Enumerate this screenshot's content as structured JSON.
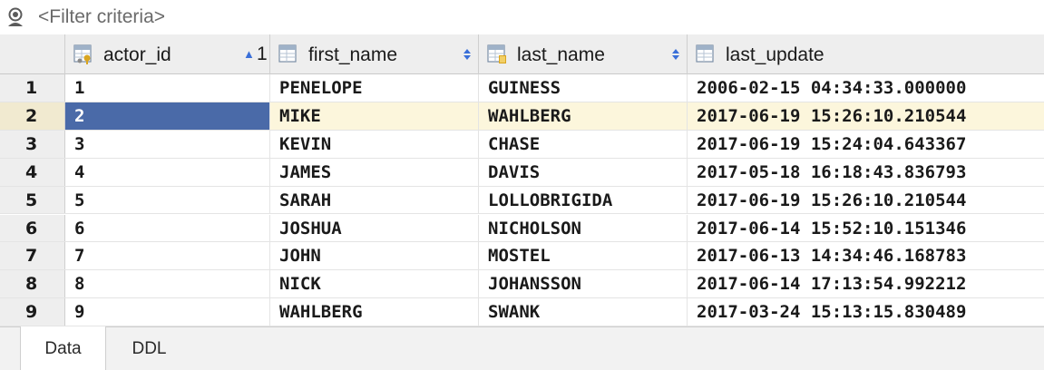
{
  "filter": {
    "placeholder": "<Filter criteria>"
  },
  "columns": [
    {
      "label": "actor_id",
      "icon": "primary-key-column-icon",
      "sort": "ascending",
      "sort_order": "1"
    },
    {
      "label": "first_name",
      "icon": "column-icon",
      "sort": "none"
    },
    {
      "label": "last_name",
      "icon": "indexed-column-icon",
      "sort": "none"
    },
    {
      "label": "last_update",
      "icon": "column-icon"
    }
  ],
  "rows": [
    {
      "num": "1",
      "cells": [
        "1",
        "PENELOPE",
        "GUINESS",
        "2006-02-15 04:34:33.000000"
      ]
    },
    {
      "num": "2",
      "cells": [
        "2",
        "MIKE",
        "WAHLBERG",
        "2017-06-19 15:26:10.210544"
      ]
    },
    {
      "num": "3",
      "cells": [
        "3",
        "KEVIN",
        "CHASE",
        "2017-06-19 15:24:04.643367"
      ]
    },
    {
      "num": "4",
      "cells": [
        "4",
        "JAMES",
        "DAVIS",
        "2017-05-18 16:18:43.836793"
      ]
    },
    {
      "num": "5",
      "cells": [
        "5",
        "SARAH",
        "LOLLOBRIGIDA",
        "2017-06-19 15:26:10.210544"
      ]
    },
    {
      "num": "6",
      "cells": [
        "6",
        "JOSHUA",
        "NICHOLSON",
        "2017-06-14 15:52:10.151346"
      ]
    },
    {
      "num": "7",
      "cells": [
        "7",
        "JOHN",
        "MOSTEL",
        "2017-06-13 14:34:46.168783"
      ]
    },
    {
      "num": "8",
      "cells": [
        "8",
        "NICK",
        "JOHANSSON",
        "2017-06-14 17:13:54.992212"
      ]
    },
    {
      "num": "9",
      "cells": [
        "9",
        "WAHLBERG",
        "SWANK",
        "2017-03-24 15:13:15.830489"
      ]
    }
  ],
  "current_row": 2,
  "tabs": [
    {
      "label": "Data",
      "active": true
    },
    {
      "label": "DDL",
      "active": false
    }
  ],
  "colors": {
    "selection": "#4a6aa8",
    "current_row": "#fcf6dc",
    "header_bg": "#eeeeee",
    "sort_arrow": "#3a6fd8"
  }
}
